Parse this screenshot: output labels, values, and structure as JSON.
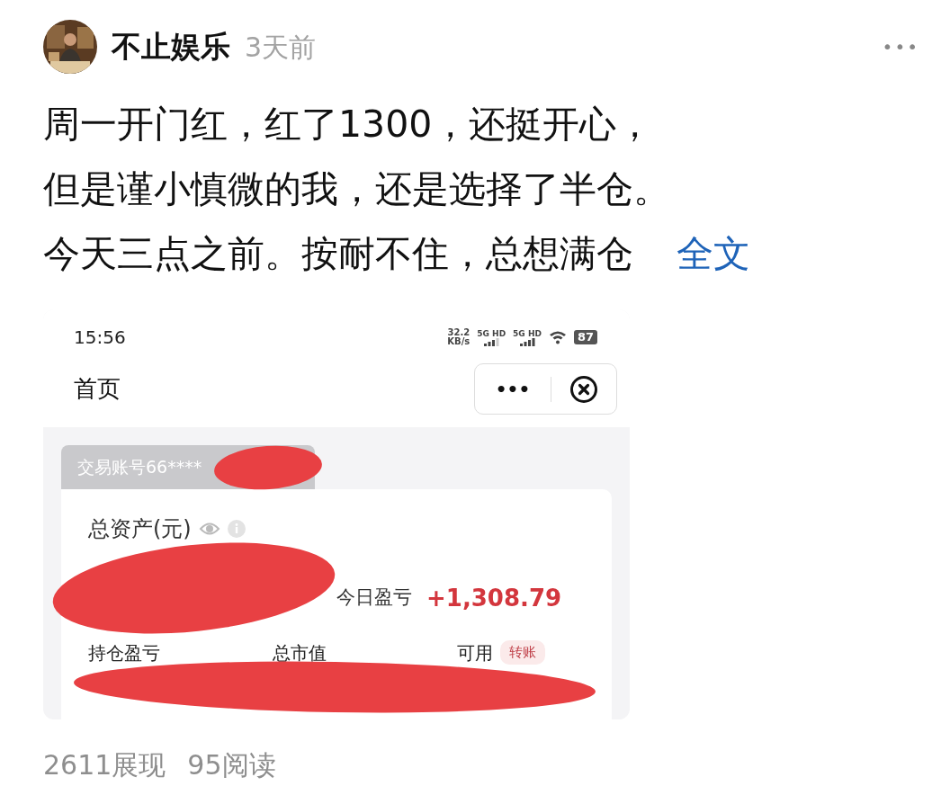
{
  "post": {
    "author": "不止娱乐",
    "time": "3天前",
    "more": "•••",
    "lines": [
      "周一开门红，红了1300，还挺开心，",
      "但是谨小慎微的我，还是选择了半仓。",
      "今天三点之前。按耐不住，总想满仓"
    ],
    "expand_link": "全文"
  },
  "screenshot": {
    "status_time": "15:56",
    "net_speed": [
      "32.2",
      "KB/s"
    ],
    "signals": [
      {
        "label": "5G HD"
      },
      {
        "label": "5G HD"
      }
    ],
    "battery": "87",
    "page_title": "首页",
    "capsule_more": "•••",
    "account_tab": "交易账号66****",
    "total_assets_label": "总资产(元)",
    "today_pl_label": "今日盈亏",
    "today_pl_value": "+1,308.79",
    "columns": [
      {
        "label": "持仓盈亏"
      },
      {
        "label": "总市值"
      },
      {
        "label": "可用",
        "badge": "转账"
      }
    ]
  },
  "stats": [
    "2611展现",
    "95阅读"
  ]
}
